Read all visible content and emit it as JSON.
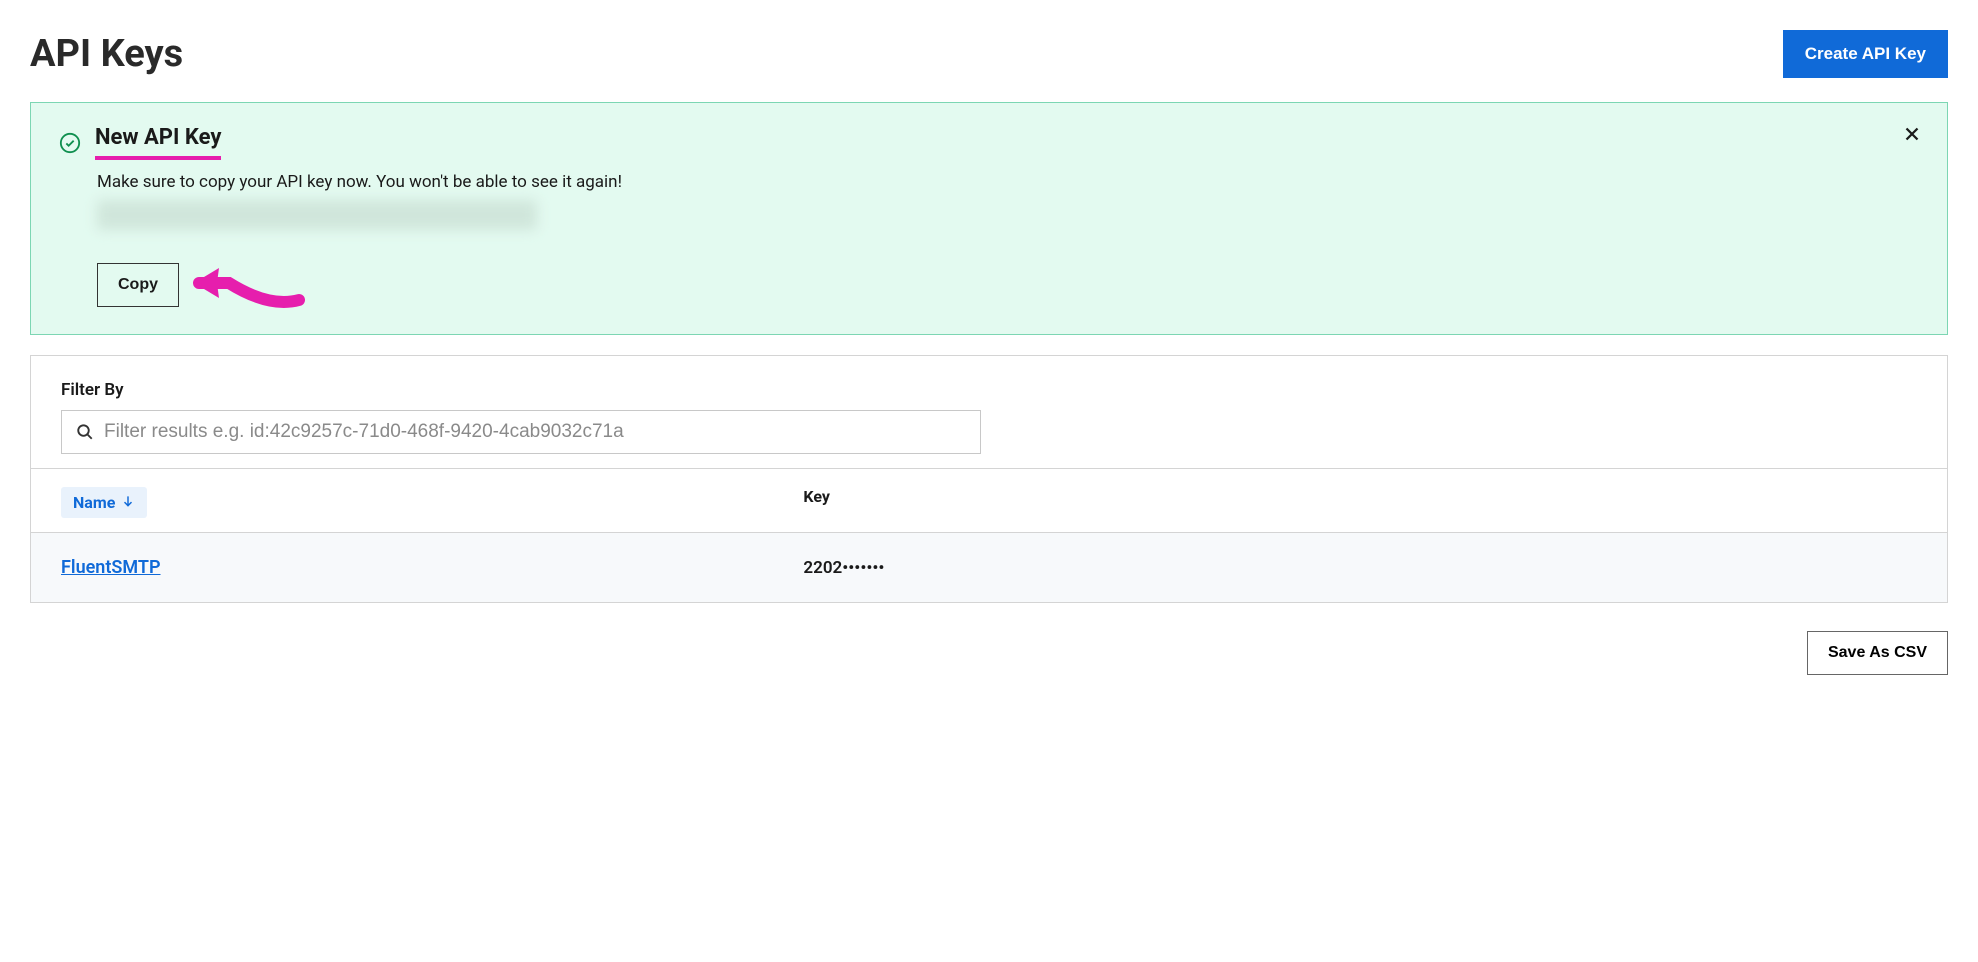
{
  "header": {
    "title": "API Keys",
    "create_button": "Create API Key"
  },
  "alert": {
    "title": "New API Key",
    "message": "Make sure to copy your API key now. You won't be able to see it again!",
    "copy_button": "Copy"
  },
  "filter": {
    "label": "Filter By",
    "placeholder": "Filter results e.g. id:42c9257c-71d0-468f-9420-4cab9032c71a"
  },
  "table": {
    "columns": {
      "name": "Name",
      "key": "Key"
    },
    "rows": [
      {
        "name": "FluentSMTP",
        "key": "2202•••••••"
      }
    ]
  },
  "footer": {
    "save_csv": "Save As CSV"
  }
}
